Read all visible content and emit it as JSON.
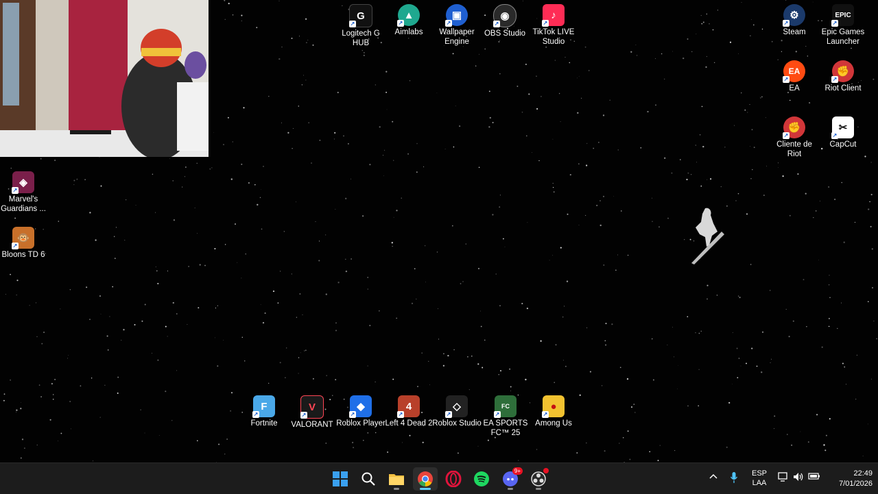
{
  "desktop": {
    "top_icons": [
      {
        "label": "Logitech G HUB",
        "icon": "logitech-g-icon",
        "color": "#111111"
      },
      {
        "label": "Aimlabs",
        "icon": "aimlabs-icon",
        "color": "#1fa88f"
      },
      {
        "label": "Wallpaper Engine",
        "icon": "wallpaper-engine-icon",
        "color": "#1f5fd0"
      },
      {
        "label": "OBS Studio",
        "icon": "obs-icon",
        "color": "#2a2a2a"
      },
      {
        "label": "TikTok LIVE Studio",
        "icon": "tiktok-live-icon",
        "color": "#fe2c55"
      }
    ],
    "right_icons": [
      {
        "label": "Steam",
        "icon": "steam-icon",
        "color": "#1b3a6b"
      },
      {
        "label": "Epic Games Launcher",
        "icon": "epic-games-icon",
        "color": "#111111"
      },
      {
        "label": "EA",
        "icon": "ea-icon",
        "color": "#ff4b12"
      },
      {
        "label": "Riot Client",
        "icon": "riot-client-icon",
        "color": "#d13639"
      },
      {
        "label": "Cliente de Riot",
        "icon": "riot-client-icon",
        "color": "#d13639"
      },
      {
        "label": "CapCut",
        "icon": "capcut-icon",
        "color": "#111111"
      }
    ],
    "left_icons": [
      {
        "label": "Marvel's Guardians ...",
        "icon": "guardians-icon",
        "color": "#7a1f4a"
      },
      {
        "label": "Bloons TD 6",
        "icon": "bloons-icon",
        "color": "#c8702a"
      }
    ],
    "bottom_icons": [
      {
        "label": "Fortnite",
        "icon": "fortnite-icon",
        "color": "#4aa8e8"
      },
      {
        "label": "VALORANT",
        "icon": "valorant-icon",
        "color": "#ff4655"
      },
      {
        "label": "Roblox Player",
        "icon": "roblox-icon",
        "color": "#1f6fe8"
      },
      {
        "label": "Left 4 Dead 2",
        "icon": "left4dead-icon",
        "color": "#b8402a"
      },
      {
        "label": "Roblox Studio",
        "icon": "roblox-studio-icon",
        "color": "#222222"
      },
      {
        "label": "EA SPORTS FC™ 25",
        "icon": "easports-fc-icon",
        "color": "#2e6e3a"
      },
      {
        "label": "Among Us",
        "icon": "among-us-icon",
        "color": "#c51111"
      }
    ]
  },
  "taskbar": {
    "apps": [
      {
        "icon": "windows-start-icon"
      },
      {
        "icon": "search-icon"
      },
      {
        "icon": "file-explorer-icon"
      },
      {
        "icon": "chrome-icon"
      },
      {
        "icon": "opera-gx-icon"
      },
      {
        "icon": "spotify-icon"
      },
      {
        "icon": "discord-icon",
        "badge": "9+"
      },
      {
        "icon": "obs-icon"
      }
    ],
    "tray": {
      "language_line1": "ESP",
      "language_line2": "LAA",
      "time": "22:49",
      "date": "7/01/2026"
    }
  }
}
